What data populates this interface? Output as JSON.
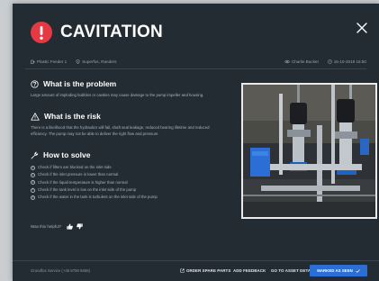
{
  "header": {
    "title": "CAVITATION",
    "alert_icon": "exclamation-circle-icon",
    "close_icon": "close-icon"
  },
  "meta": {
    "pump": "Plastic Feeder 1",
    "location": "Superfos, Randers",
    "user": "Charlie Bucket",
    "timestamp": "15-10-2019 15:50"
  },
  "problem": {
    "heading": "What is the problem",
    "text": "Large amount of imploding bubbles or cavities may cause damage to the pump impeller and housing."
  },
  "risk": {
    "heading": "What is the risk",
    "text": "There is a likelihood that the hydraulics will fail, shaft seal leakage, reduced bearing lifetime and reduced efficiency. The pump may not be able to deliver the right flow and pressure."
  },
  "solve": {
    "heading": "How to solve",
    "steps": [
      {
        "n": "1",
        "text": "Check if filters are blocked on the inlet side"
      },
      {
        "n": "2",
        "text": "Check if the inlet pressure is lower than normal"
      },
      {
        "n": "3",
        "text": "Check if the liquid temperature is higher than normal"
      },
      {
        "n": "4",
        "text": "Check if the tank level is low on the inlet side of the pump"
      },
      {
        "n": "5",
        "text": "Check if the water in the tank is turbulent on the inlet side of the pump"
      }
    ]
  },
  "feedback": {
    "question": "Was this helpful?"
  },
  "footer": {
    "service": "Grundfos Service (+45 8750 5656)",
    "order_spare_parts": "ORDER SPARE PARTS",
    "add_feedback": "ADD FEEDBACK",
    "go_to_asset": "GO TO ASSET DETAILS",
    "mark_as_seen": "MARKED AS SEEN"
  },
  "colors": {
    "background": "#232b33",
    "alert": "#e53a43",
    "primary": "#2a6ed6"
  }
}
